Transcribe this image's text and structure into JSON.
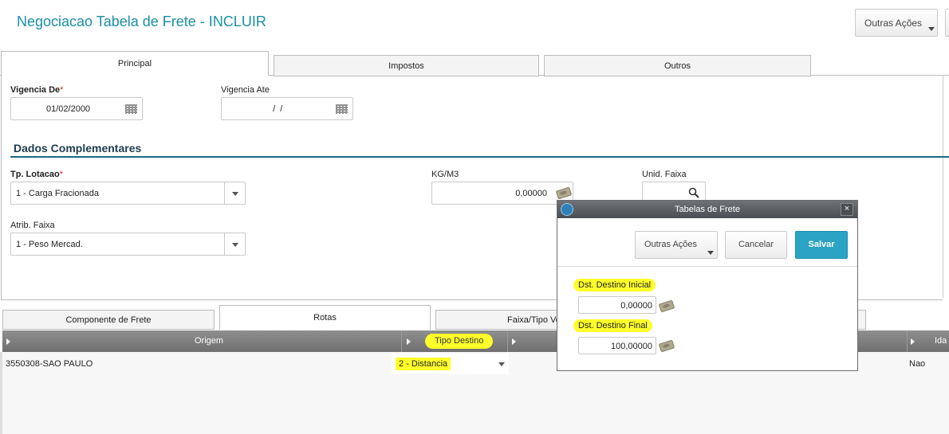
{
  "header": {
    "title": "Negociacao Tabela de Frete - INCLUIR",
    "actions_label": "Outras Ações"
  },
  "tabs": [
    {
      "label": "Principal"
    },
    {
      "label": "Impostos"
    },
    {
      "label": "Outros"
    }
  ],
  "form": {
    "vigencia_de": {
      "label": "Vigencia De",
      "required_mark": "*",
      "value": "01/02/2000"
    },
    "vigencia_ate": {
      "label": "Vigencia Ate",
      "value": "  /  /"
    },
    "section_title": "Dados Complementares",
    "tp_lotacao": {
      "label": "Tp. Lotacao",
      "required_mark": "*",
      "value": "1 - Carga Fracionada"
    },
    "kg_m3": {
      "label": "KG/M3",
      "value": "0,00000"
    },
    "unid_faixa": {
      "label": "Unid. Faixa",
      "value": ""
    },
    "atrib_faixa": {
      "label": "Atrib. Faixa",
      "value": "1 - Peso Mercad."
    }
  },
  "bottom_tabs": [
    {
      "label": "Componente de Frete"
    },
    {
      "label": "Rotas"
    },
    {
      "label": "Faixa/Tipo Ve"
    }
  ],
  "grid": {
    "columns": [
      "Origem",
      "Tipo Destino",
      "Ida"
    ],
    "rows": [
      {
        "origem": "3550308-SAO PAULO",
        "tipo_destino": "2 - Distancia",
        "ida": "Nao"
      }
    ]
  },
  "dialog": {
    "title": "Tabelas de Frete",
    "actions_label": "Outras Ações",
    "cancel_label": "Cancelar",
    "save_label": "Salvar",
    "dst_inicial": {
      "label": "Dst. Destino Inicial",
      "value": "0,00000"
    },
    "dst_final": {
      "label": "Dst. Destino Final",
      "value": "100,00000"
    }
  },
  "colors": {
    "title": "#1a8fa5",
    "save_button": "#2ba3c4",
    "highlight": "#ffff2a"
  }
}
